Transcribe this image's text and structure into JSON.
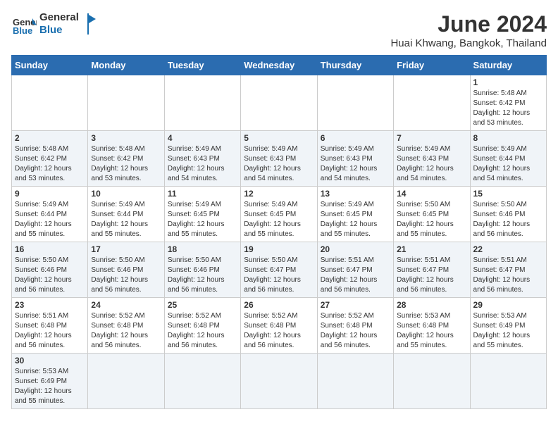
{
  "logo": {
    "text_general": "General",
    "text_blue": "Blue"
  },
  "title": "June 2024",
  "location": "Huai Khwang, Bangkok, Thailand",
  "weekdays": [
    "Sunday",
    "Monday",
    "Tuesday",
    "Wednesday",
    "Thursday",
    "Friday",
    "Saturday"
  ],
  "weeks": [
    [
      {
        "day": "",
        "info": ""
      },
      {
        "day": "",
        "info": ""
      },
      {
        "day": "",
        "info": ""
      },
      {
        "day": "",
        "info": ""
      },
      {
        "day": "",
        "info": ""
      },
      {
        "day": "",
        "info": ""
      },
      {
        "day": "1",
        "info": "Sunrise: 5:48 AM\nSunset: 6:42 PM\nDaylight: 12 hours and 53 minutes."
      }
    ],
    [
      {
        "day": "2",
        "info": "Sunrise: 5:48 AM\nSunset: 6:42 PM\nDaylight: 12 hours and 53 minutes."
      },
      {
        "day": "3",
        "info": "Sunrise: 5:48 AM\nSunset: 6:42 PM\nDaylight: 12 hours and 53 minutes."
      },
      {
        "day": "4",
        "info": "Sunrise: 5:49 AM\nSunset: 6:43 PM\nDaylight: 12 hours and 54 minutes."
      },
      {
        "day": "5",
        "info": "Sunrise: 5:49 AM\nSunset: 6:43 PM\nDaylight: 12 hours and 54 minutes."
      },
      {
        "day": "6",
        "info": "Sunrise: 5:49 AM\nSunset: 6:43 PM\nDaylight: 12 hours and 54 minutes."
      },
      {
        "day": "7",
        "info": "Sunrise: 5:49 AM\nSunset: 6:43 PM\nDaylight: 12 hours and 54 minutes."
      },
      {
        "day": "8",
        "info": "Sunrise: 5:49 AM\nSunset: 6:44 PM\nDaylight: 12 hours and 54 minutes."
      }
    ],
    [
      {
        "day": "9",
        "info": "Sunrise: 5:49 AM\nSunset: 6:44 PM\nDaylight: 12 hours and 55 minutes."
      },
      {
        "day": "10",
        "info": "Sunrise: 5:49 AM\nSunset: 6:44 PM\nDaylight: 12 hours and 55 minutes."
      },
      {
        "day": "11",
        "info": "Sunrise: 5:49 AM\nSunset: 6:45 PM\nDaylight: 12 hours and 55 minutes."
      },
      {
        "day": "12",
        "info": "Sunrise: 5:49 AM\nSunset: 6:45 PM\nDaylight: 12 hours and 55 minutes."
      },
      {
        "day": "13",
        "info": "Sunrise: 5:49 AM\nSunset: 6:45 PM\nDaylight: 12 hours and 55 minutes."
      },
      {
        "day": "14",
        "info": "Sunrise: 5:50 AM\nSunset: 6:45 PM\nDaylight: 12 hours and 55 minutes."
      },
      {
        "day": "15",
        "info": "Sunrise: 5:50 AM\nSunset: 6:46 PM\nDaylight: 12 hours and 56 minutes."
      }
    ],
    [
      {
        "day": "16",
        "info": "Sunrise: 5:50 AM\nSunset: 6:46 PM\nDaylight: 12 hours and 56 minutes."
      },
      {
        "day": "17",
        "info": "Sunrise: 5:50 AM\nSunset: 6:46 PM\nDaylight: 12 hours and 56 minutes."
      },
      {
        "day": "18",
        "info": "Sunrise: 5:50 AM\nSunset: 6:46 PM\nDaylight: 12 hours and 56 minutes."
      },
      {
        "day": "19",
        "info": "Sunrise: 5:50 AM\nSunset: 6:47 PM\nDaylight: 12 hours and 56 minutes."
      },
      {
        "day": "20",
        "info": "Sunrise: 5:51 AM\nSunset: 6:47 PM\nDaylight: 12 hours and 56 minutes."
      },
      {
        "day": "21",
        "info": "Sunrise: 5:51 AM\nSunset: 6:47 PM\nDaylight: 12 hours and 56 minutes."
      },
      {
        "day": "22",
        "info": "Sunrise: 5:51 AM\nSunset: 6:47 PM\nDaylight: 12 hours and 56 minutes."
      }
    ],
    [
      {
        "day": "23",
        "info": "Sunrise: 5:51 AM\nSunset: 6:48 PM\nDaylight: 12 hours and 56 minutes."
      },
      {
        "day": "24",
        "info": "Sunrise: 5:52 AM\nSunset: 6:48 PM\nDaylight: 12 hours and 56 minutes."
      },
      {
        "day": "25",
        "info": "Sunrise: 5:52 AM\nSunset: 6:48 PM\nDaylight: 12 hours and 56 minutes."
      },
      {
        "day": "26",
        "info": "Sunrise: 5:52 AM\nSunset: 6:48 PM\nDaylight: 12 hours and 56 minutes."
      },
      {
        "day": "27",
        "info": "Sunrise: 5:52 AM\nSunset: 6:48 PM\nDaylight: 12 hours and 56 minutes."
      },
      {
        "day": "28",
        "info": "Sunrise: 5:53 AM\nSunset: 6:48 PM\nDaylight: 12 hours and 55 minutes."
      },
      {
        "day": "29",
        "info": "Sunrise: 5:53 AM\nSunset: 6:49 PM\nDaylight: 12 hours and 55 minutes."
      }
    ],
    [
      {
        "day": "30",
        "info": "Sunrise: 5:53 AM\nSunset: 6:49 PM\nDaylight: 12 hours and 55 minutes."
      },
      {
        "day": "",
        "info": ""
      },
      {
        "day": "",
        "info": ""
      },
      {
        "day": "",
        "info": ""
      },
      {
        "day": "",
        "info": ""
      },
      {
        "day": "",
        "info": ""
      },
      {
        "day": "",
        "info": ""
      }
    ]
  ]
}
